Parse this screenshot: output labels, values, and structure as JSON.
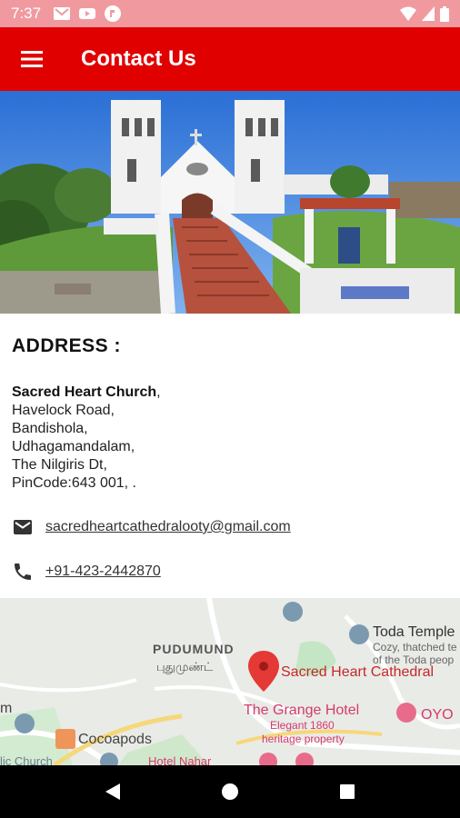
{
  "status_bar": {
    "time": "7:37",
    "icons": [
      "gmail-icon",
      "youtube-icon",
      "app-icon",
      "wifi-icon",
      "signal-icon",
      "battery-icon"
    ]
  },
  "app_bar": {
    "title": "Contact Us",
    "menu_icon": "hamburger-menu-icon",
    "color": "#e00000"
  },
  "address": {
    "heading": "ADDRESS :",
    "name": "Sacred Heart Church",
    "name_suffix": ",",
    "lines": [
      "Havelock Road,",
      "Bandishola,",
      "Udhagamandalam,",
      "The Nilgiris Dt,",
      "PinCode:643 001, ."
    ]
  },
  "contact": {
    "email": "sacredheartcathedralooty@gmail.com",
    "email_icon": "mail-icon",
    "phone": "+91-423-2442870",
    "phone_icon": "phone-icon"
  },
  "map": {
    "labels": {
      "toda": "Toda Temple",
      "toda_sub1": "Cozy, thatched te",
      "toda_sub2": "of the Toda peop",
      "pudumund": "PUDUMUND",
      "pudumund_tamil": "புதுமுண்ட்",
      "cathedral": "Sacred Heart Cathedral",
      "grange": "The Grange Hotel",
      "grange_sub1": "Elegant 1860",
      "grange_sub2": "heritage property",
      "cocoapods": "Cocoapods",
      "oyo": "OYO",
      "hotel": "Hotel Nahar",
      "m": "m",
      "church_short": "lic Church"
    }
  },
  "nav_bar": {
    "back": "back-icon",
    "home": "home-icon",
    "recents": "recents-icon"
  }
}
